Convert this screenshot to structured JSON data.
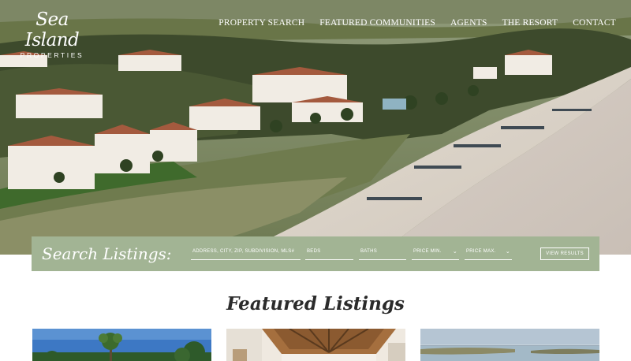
{
  "brand": {
    "name_script": "Sea Island",
    "name_sub": "PROPERTIES"
  },
  "nav": {
    "items": [
      {
        "label": "PROPERTY SEARCH"
      },
      {
        "label": "FEATURED COMMUNITIES"
      },
      {
        "label": "AGENTS"
      },
      {
        "label": "THE RESORT"
      },
      {
        "label": "CONTACT"
      }
    ]
  },
  "search": {
    "title": "Search Listings:",
    "address_placeholder": "ADDRESS, CITY, ZIP, SUBDIVISION, MLS#",
    "beds_placeholder": "BEDS",
    "baths_placeholder": "BATHS",
    "price_min_label": "PRICE MIN.",
    "price_max_label": "PRICE MAX.",
    "submit_label": "VIEW RESULTS"
  },
  "featured": {
    "title": "Featured Listings",
    "cards": [
      {
        "image": "palm-trees-photo"
      },
      {
        "image": "wood-ceiling-interior-photo"
      },
      {
        "image": "marsh-water-view-photo"
      }
    ]
  },
  "colors": {
    "search_bar": "#a2b494",
    "text_dark": "#2b2b2b",
    "nav_text": "#ffffff"
  }
}
